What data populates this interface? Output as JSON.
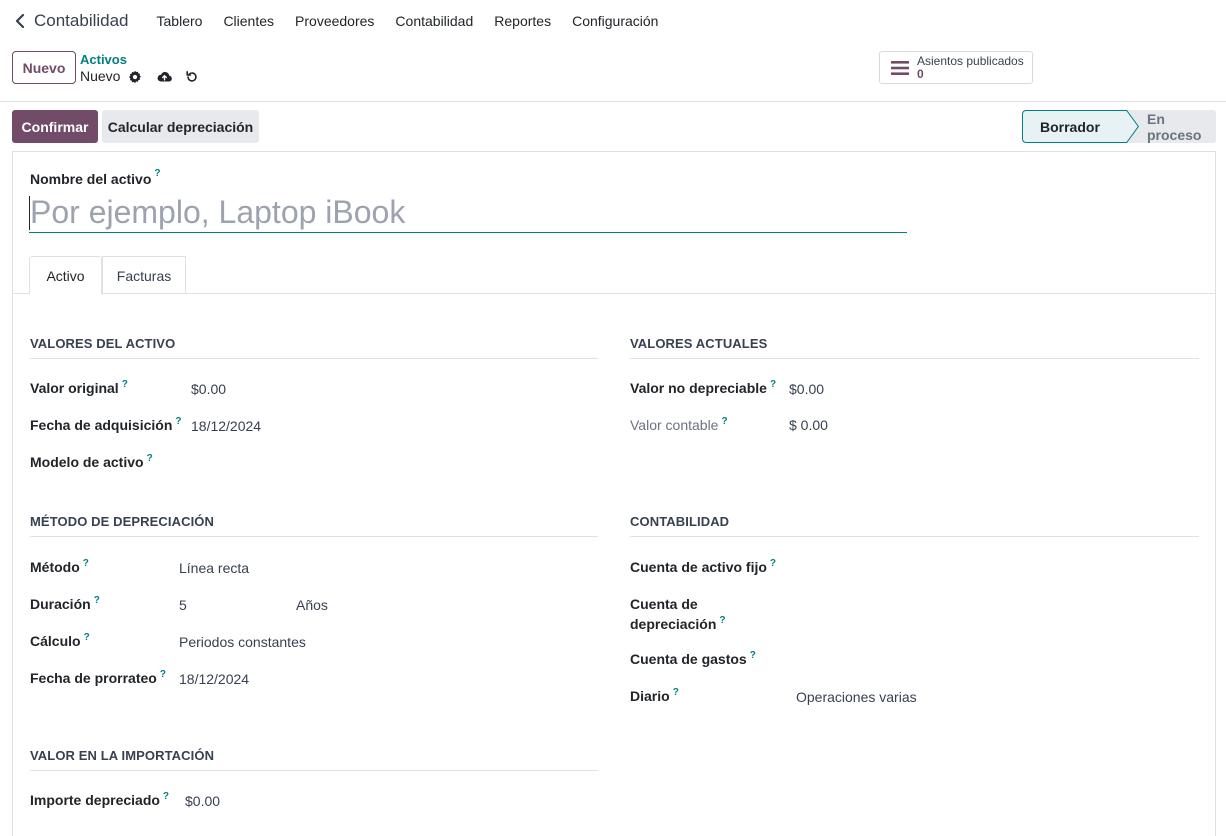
{
  "navbar": {
    "app_title": "Contabilidad",
    "menu": [
      "Tablero",
      "Clientes",
      "Proveedores",
      "Contabilidad",
      "Reportes",
      "Configuración"
    ]
  },
  "control_panel": {
    "new_button": "Nuevo",
    "breadcrumb_parent": "Activos",
    "breadcrumb_current": "Nuevo",
    "smart_button": {
      "label": "Asientos publicados",
      "value": "0"
    }
  },
  "statusbar": {
    "confirm": "Confirmar",
    "compute_depreciation": "Calcular depreciación",
    "stages": [
      "Borrador",
      "En proceso"
    ],
    "active_stage": "Borrador"
  },
  "form": {
    "name_label": "Nombre del activo",
    "name_placeholder": "Por ejemplo, Laptop iBook",
    "help_mark": "?",
    "tabs": [
      "Activo",
      "Facturas"
    ],
    "asset_values": {
      "title": "VALORES DEL ACTIVO",
      "original_value_label": "Valor original",
      "original_value": "$0.00",
      "acquisition_date_label": "Fecha de adquisición",
      "acquisition_date": "18/12/2024",
      "asset_model_label": "Modelo de activo"
    },
    "current_values": {
      "title": "VALORES ACTUALES",
      "non_depreciable_label": "Valor no depreciable",
      "non_depreciable": "$0.00",
      "book_value_label": "Valor contable",
      "book_value": "$ 0.00"
    },
    "depreciation_method": {
      "title": "MÉTODO DE DEPRECIACIÓN",
      "method_label": "Método",
      "method": "Línea recta",
      "duration_label": "Duración",
      "duration": "5",
      "duration_unit": "Años",
      "computation_label": "Cálculo",
      "computation": "Periodos constantes",
      "prorata_date_label": "Fecha de prorrateo",
      "prorata_date": "18/12/2024"
    },
    "accounting": {
      "title": "CONTABILIDAD",
      "fixed_asset_account_label": "Cuenta de activo fijo",
      "depreciation_account_label_1": "Cuenta de",
      "depreciation_account_label_2": "depreciación",
      "expense_account_label": "Cuenta de gastos",
      "journal_label": "Diario",
      "journal": "Operaciones varias"
    },
    "import_value": {
      "title": "VALOR EN LA IMPORTACIÓN",
      "depreciated_amount_label": "Importe depreciado",
      "depreciated_amount": "$0.00"
    }
  },
  "colors": {
    "brand": "#714b67",
    "accent": "#017e84"
  }
}
